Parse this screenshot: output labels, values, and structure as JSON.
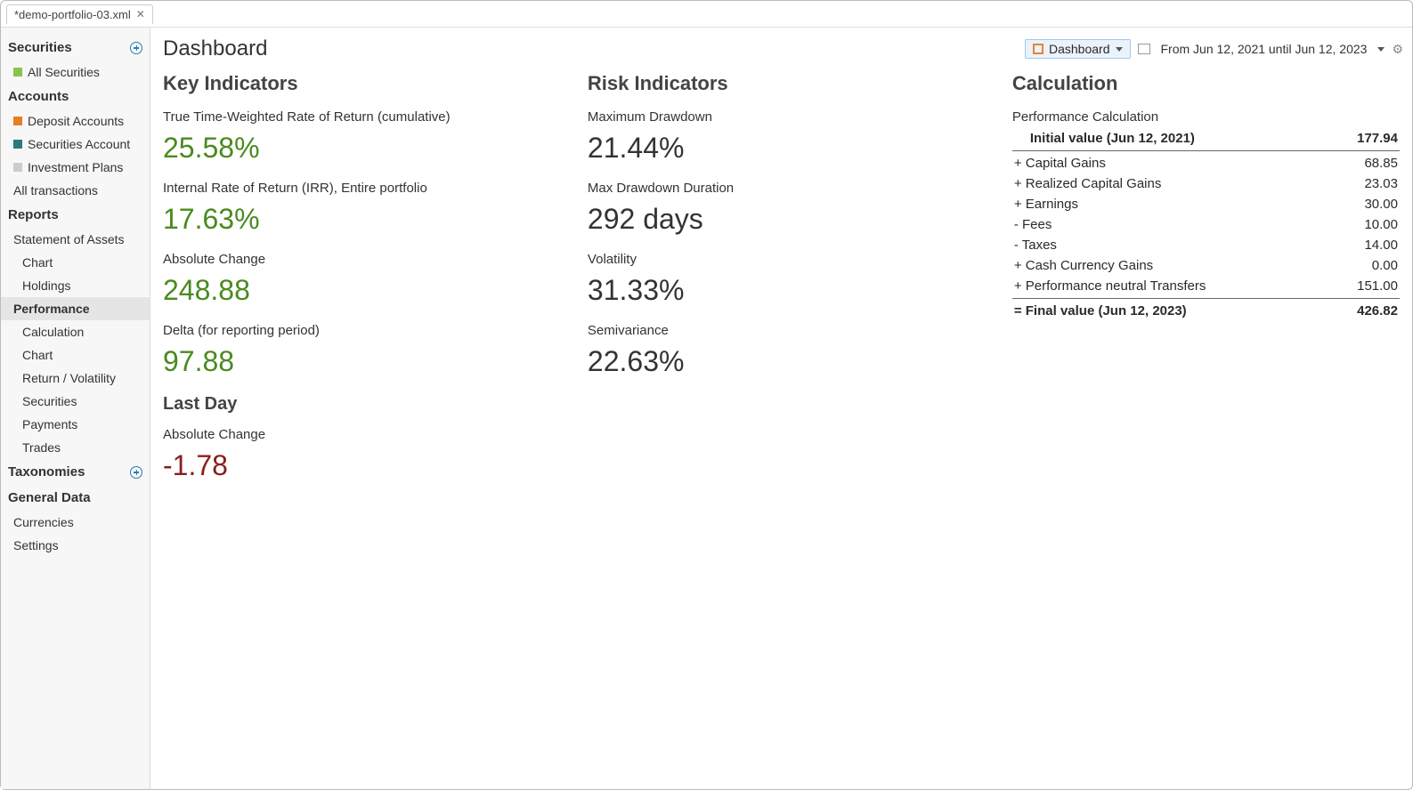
{
  "tab": {
    "title": "*demo-portfolio-03.xml"
  },
  "sidebar": {
    "securities": {
      "header": "Securities",
      "allSecurities": "All Securities"
    },
    "accounts": {
      "header": "Accounts",
      "deposit": "Deposit Accounts",
      "securitiesAcct": "Securities Account",
      "investmentPlans": "Investment Plans",
      "allTransactions": "All transactions"
    },
    "reports": {
      "header": "Reports",
      "statementOfAssets": "Statement of Assets",
      "chart": "Chart",
      "holdings": "Holdings",
      "performance": "Performance",
      "calculation": "Calculation",
      "chart2": "Chart",
      "returnVolatility": "Return / Volatility",
      "securities": "Securities",
      "payments": "Payments",
      "trades": "Trades"
    },
    "taxonomies": {
      "header": "Taxonomies"
    },
    "generalData": {
      "header": "General Data",
      "currencies": "Currencies",
      "settings": "Settings"
    }
  },
  "header": {
    "title": "Dashboard",
    "dashboardButton": "Dashboard",
    "dateRange": "From Jun 12, 2021 until Jun 12, 2023"
  },
  "keyIndicators": {
    "title": "Key Indicators",
    "ttwror": {
      "label": "True Time-Weighted Rate of Return (cumulative)",
      "value": "25.58%"
    },
    "irr": {
      "label": "Internal Rate of Return (IRR), Entire portfolio",
      "value": "17.63%"
    },
    "absoluteChange": {
      "label": "Absolute Change",
      "value": "248.88"
    },
    "delta": {
      "label": "Delta (for reporting period)",
      "value": "97.88"
    },
    "lastDayTitle": "Last Day",
    "lastDayAbsoluteChange": {
      "label": "Absolute Change",
      "value": "-1.78"
    }
  },
  "riskIndicators": {
    "title": "Risk Indicators",
    "maxDrawdown": {
      "label": "Maximum Drawdown",
      "value": "21.44%"
    },
    "maxDrawdownDuration": {
      "label": "Max Drawdown Duration",
      "value": "292 days"
    },
    "volatility": {
      "label": "Volatility",
      "value": "31.33%"
    },
    "semivariance": {
      "label": "Semivariance",
      "value": "22.63%"
    }
  },
  "calculation": {
    "title": "Calculation",
    "subtitle": "Performance Calculation",
    "initial": {
      "label": "Initial value (Jun 12, 2021)",
      "value": "177.94"
    },
    "rows": [
      {
        "label": "+ Capital Gains",
        "value": "68.85"
      },
      {
        "label": "+ Realized Capital Gains",
        "value": "23.03"
      },
      {
        "label": "+ Earnings",
        "value": "30.00"
      },
      {
        "label": "-  Fees",
        "value": "10.00"
      },
      {
        "label": "-  Taxes",
        "value": "14.00"
      },
      {
        "label": "+ Cash Currency Gains",
        "value": "0.00"
      },
      {
        "label": "+ Performance neutral Transfers",
        "value": "151.00"
      }
    ],
    "final": {
      "label": "= Final value (Jun 12, 2023)",
      "value": "426.82"
    }
  }
}
